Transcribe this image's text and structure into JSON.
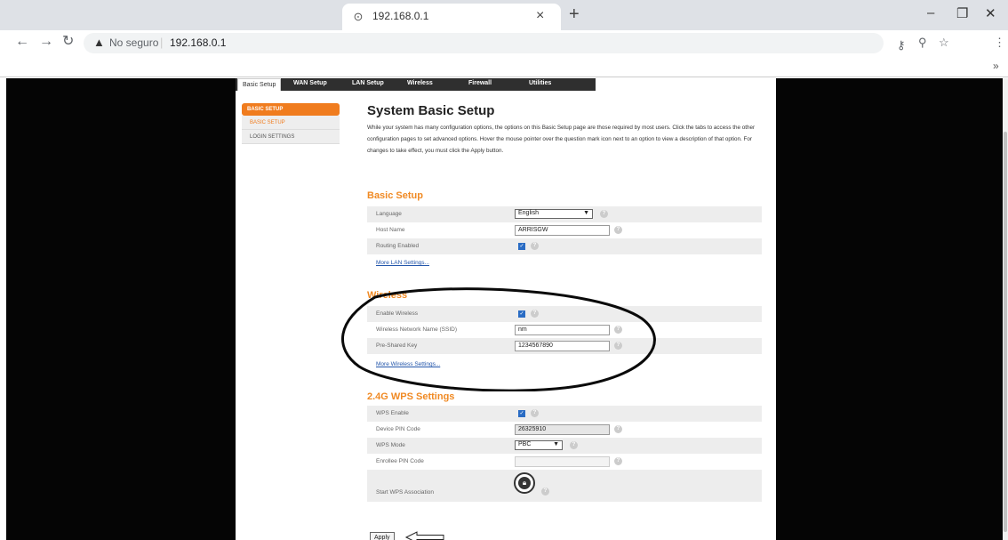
{
  "browser": {
    "tab_title": "192.168.0.1",
    "tab_close": "×",
    "new_tab": "+",
    "not_secure": "No seguro",
    "url": "192.168.0.1",
    "bookmarks_more": "»"
  },
  "router_tabs": [
    "Basic Setup",
    "WAN Setup",
    "LAN Setup",
    "Wireless",
    "Firewall",
    "Utilities"
  ],
  "sidebar": {
    "header": "BASIC SETUP",
    "items": [
      "BASIC SETUP",
      "LOGIN SETTINGS"
    ]
  },
  "main": {
    "title": "System Basic Setup",
    "intro": "While your system has many configuration options, the options on this Basic Setup page are those required by most users. Click the tabs to access the other configuration pages to set advanced options. Hover the mouse pointer over the question mark icon next to an option to view a description of that option. For changes to take effect, you must click the Apply button."
  },
  "basic_setup": {
    "heading": "Basic Setup",
    "language_label": "Language",
    "language_value": "English",
    "host_label": "Host Name",
    "host_value": "ARRISGW",
    "routing_label": "Routing Enabled",
    "link": "More LAN Settings..."
  },
  "wireless": {
    "heading": "Wireless",
    "enable_label": "Enable Wireless",
    "ssid_label": "Wireless Network Name (SSID)",
    "ssid_value": "nm",
    "psk_label": "Pre-Shared Key",
    "psk_value": "1234567890",
    "link": "More Wireless Settings..."
  },
  "wps": {
    "heading": "2.4G WPS Settings",
    "enable_label": "WPS Enable",
    "pin_label": "Device PIN Code",
    "pin_value": "26325910",
    "mode_label": "WPS Mode",
    "mode_value": "PBC",
    "enrollee_label": "Enrollee PIN Code",
    "start_label": "Start WPS Association"
  },
  "apply_label": "Apply"
}
